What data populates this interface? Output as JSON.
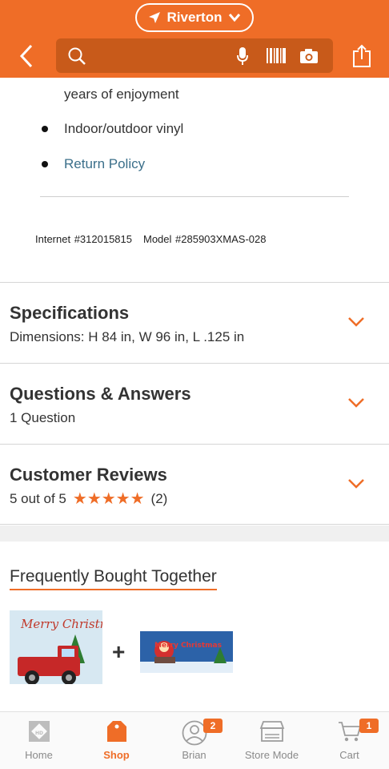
{
  "header": {
    "location": "Riverton",
    "search_placeholder": ""
  },
  "details": {
    "bullet_continuation": "years of enjoyment",
    "bullets": [
      "Indoor/outdoor vinyl",
      "Return Policy"
    ],
    "internet_id": "Internet #312015815",
    "model": "Model #285903XMAS-028"
  },
  "sections": {
    "specifications": {
      "title": "Specifications",
      "subtitle": "Dimensions: H 84 in, W 96 in, L .125 in"
    },
    "qa": {
      "title": "Questions & Answers",
      "subtitle": "1 Question"
    },
    "reviews": {
      "title": "Customer Reviews",
      "rating_text": "5 out of 5",
      "stars": 5,
      "count": "(2)"
    }
  },
  "fbt": {
    "title": "Frequently Bought Together",
    "plus": "+",
    "product1_art_text": "Merry Christmas",
    "product2_art_text": "Merry Christmas"
  },
  "nav": {
    "items": [
      {
        "label": "Home",
        "icon": "home-depot-logo-icon"
      },
      {
        "label": "Shop",
        "icon": "shop-tag-icon"
      },
      {
        "label": "Brian",
        "icon": "user-icon",
        "badge": "2"
      },
      {
        "label": "Store Mode",
        "icon": "store-icon"
      },
      {
        "label": "Cart",
        "icon": "cart-icon",
        "badge": "1"
      }
    ]
  },
  "colors": {
    "brand": "#ef6d27",
    "link": "#3b6f8a"
  }
}
